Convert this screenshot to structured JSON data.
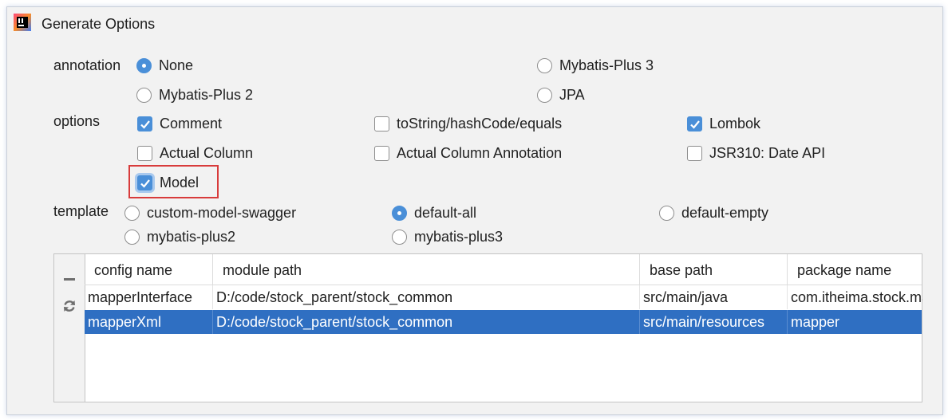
{
  "window": {
    "title": "Generate Options"
  },
  "annotation": {
    "label": "annotation",
    "options": [
      "None",
      "Mybatis-Plus 3",
      "Mybatis-Plus 2",
      "JPA"
    ],
    "selected": "None"
  },
  "options": {
    "label": "options",
    "items": [
      {
        "label": "Comment",
        "checked": true
      },
      {
        "label": "toString/hashCode/equals",
        "checked": false
      },
      {
        "label": "Lombok",
        "checked": true
      },
      {
        "label": "Actual Column",
        "checked": false
      },
      {
        "label": "Actual Column Annotation",
        "checked": false
      },
      {
        "label": "JSR310: Date API",
        "checked": false
      },
      {
        "label": "Model",
        "checked": true
      }
    ]
  },
  "template": {
    "label": "template",
    "options": [
      "custom-model-swagger",
      "default-all",
      "default-empty",
      "mybatis-plus2",
      "mybatis-plus3"
    ],
    "selected": "default-all"
  },
  "table": {
    "headers": [
      "config name",
      "module path",
      "base path",
      "package name"
    ],
    "rows": [
      [
        "mapperInterface",
        "D:/code/stock_parent/stock_common",
        "src/main/java",
        "com.itheima.stock.mapper"
      ],
      [
        "mapperXml",
        "D:/code/stock_parent/stock_common",
        "src/main/resources",
        "mapper"
      ]
    ],
    "selected_row": 1
  },
  "icons": {
    "app": "intellij-idea-icon",
    "remove": "minus-icon",
    "refresh": "refresh-icon"
  },
  "colors": {
    "accent": "#4a8fd8",
    "selection": "#2f6fc2",
    "highlight_box": "#d83b3b"
  }
}
